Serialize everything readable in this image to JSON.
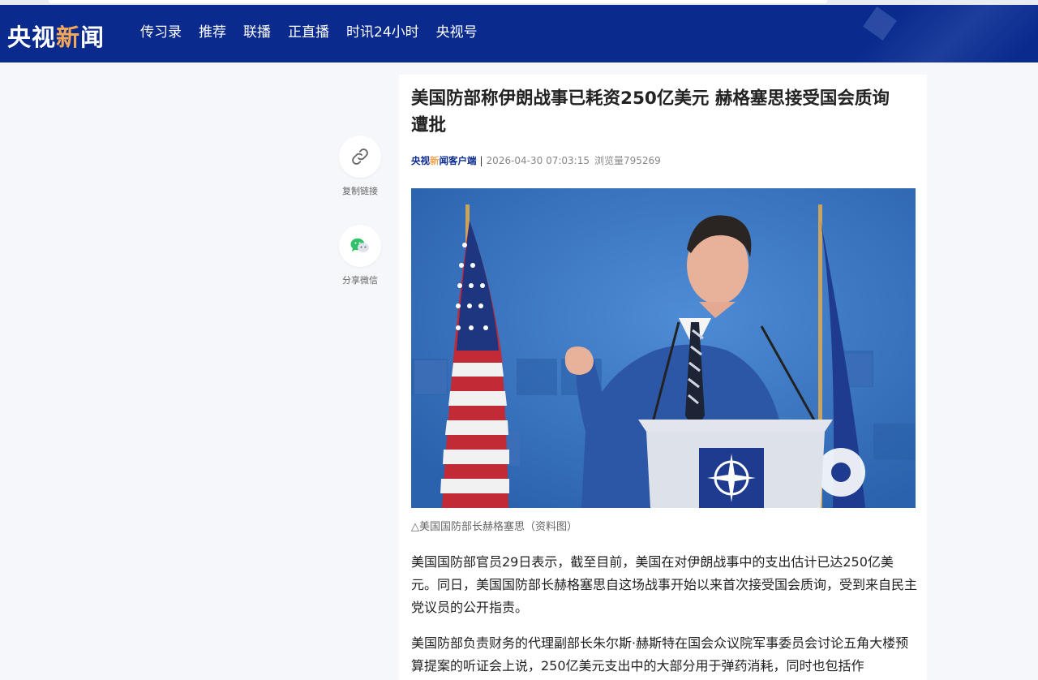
{
  "brand": {
    "logo_part1": "央视",
    "logo_part2": "新",
    "logo_part3": "闻"
  },
  "nav": {
    "items": [
      "传习录",
      "推荐",
      "联播",
      "正直播",
      "时讯24小时",
      "央视号"
    ]
  },
  "share": {
    "copy_link_label": "复制链接",
    "wechat_label": "分享微信"
  },
  "article": {
    "title": "美国防部称伊朗战事已耗资250亿美元 赫格塞思接受国会质询遭批",
    "source_part1": "央视",
    "source_part2": "新",
    "source_part3": "闻客户端",
    "separator": "|",
    "datetime": "2026-04-30 07:03:15",
    "views": "浏览量795269",
    "caption": "△美国国防部长赫格塞思（资料图）",
    "paragraphs": [
      "美国国防部官员29日表示，截至目前，美国在对伊朗战事中的支出估计已达250亿美元。同日，美国国防部长赫格塞思自这场战事开始以来首次接受国会质询，受到来自民主党议员的公开指责。",
      "美国防部负责财务的代理副部长朱尔斯·赫斯特在国会众议院军事委员会讨论五角大楼预算提案的听证会上说，250亿美元支出中的大部分用于弹药消耗，同时也包括作"
    ]
  },
  "colors": {
    "nav_bg": "#0a2a8e",
    "accent_orange": "#f2a85a",
    "page_bg": "#f5f7fa"
  },
  "icons": {
    "copy_link": "link-icon",
    "wechat": "wechat-icon"
  }
}
